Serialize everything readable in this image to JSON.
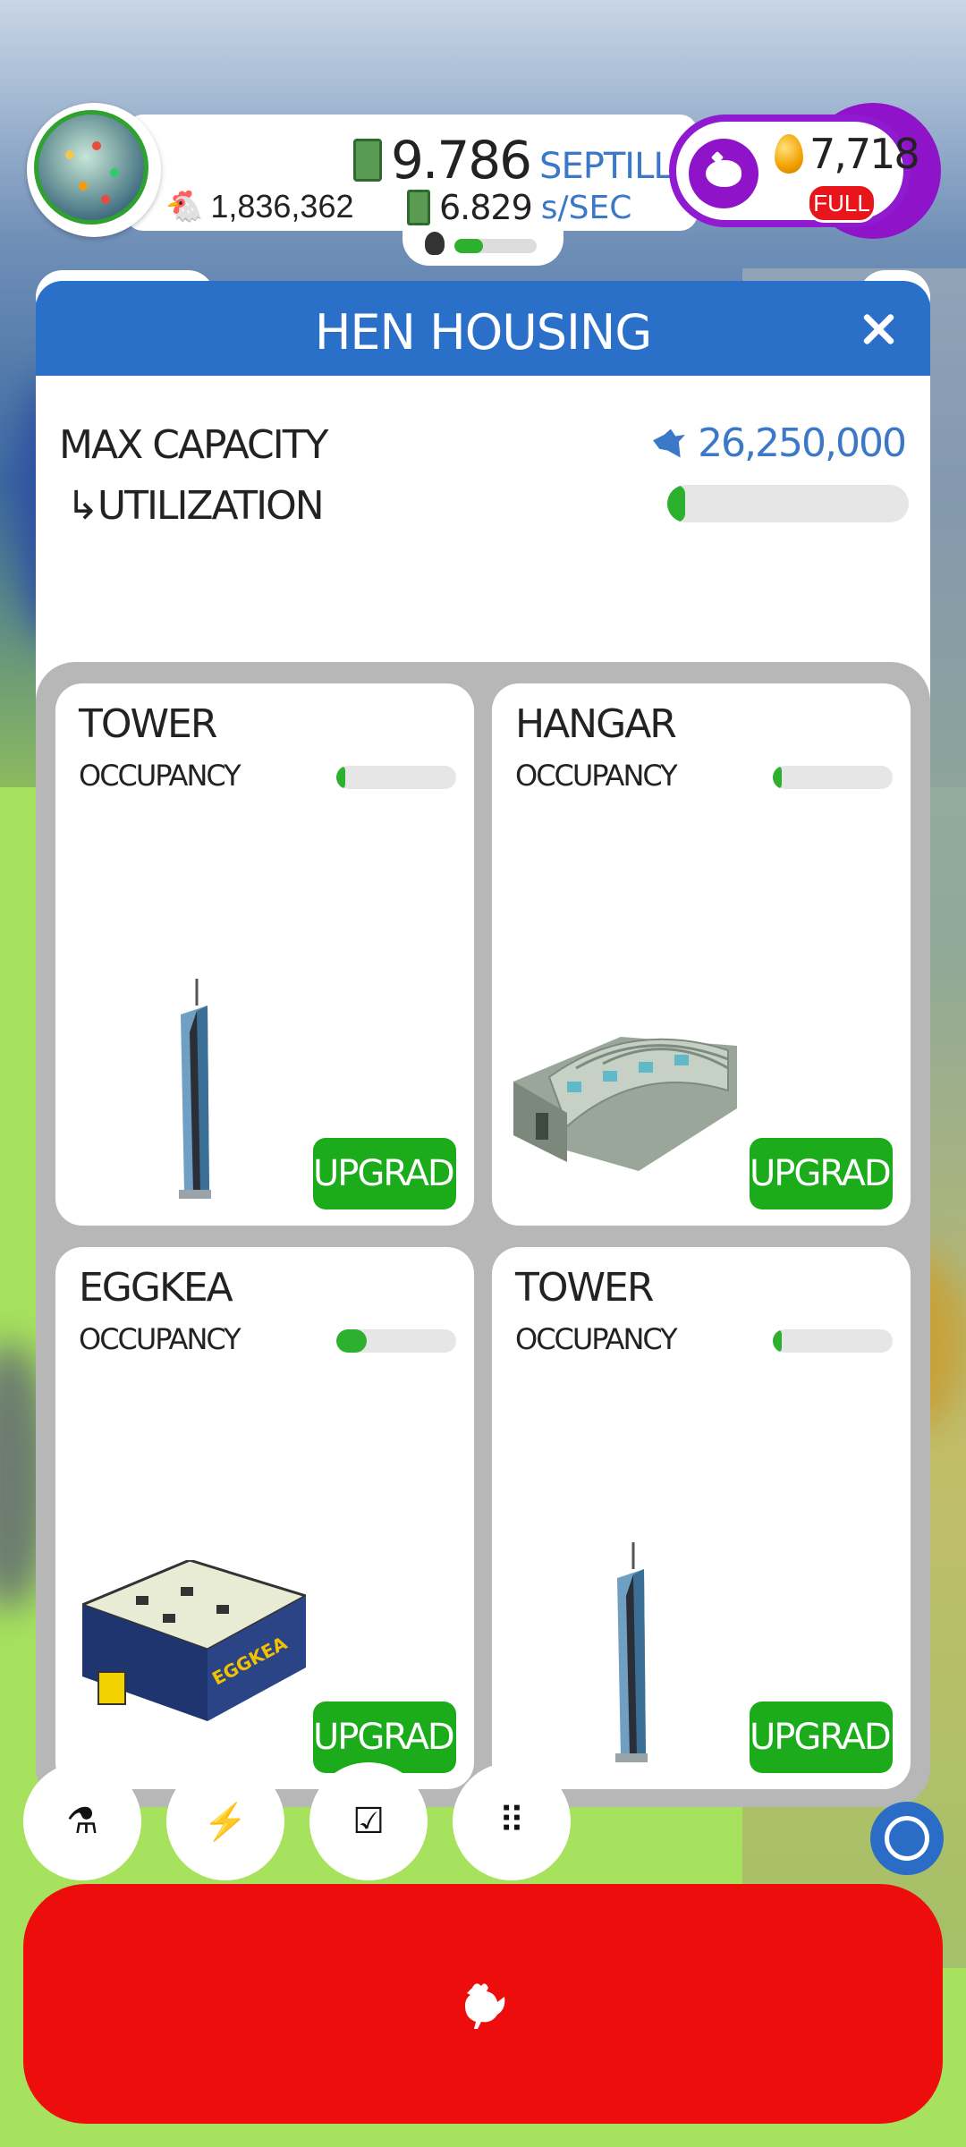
{
  "hud": {
    "hens_count": "1,836,362",
    "money_value": "9.786",
    "money_unit": "SEPTILLION",
    "rate_value": "6.829",
    "rate_unit": "s/SEC",
    "mini_progress": 0.35,
    "golden_eggs": "7,718",
    "piggy_status": "FULL"
  },
  "dialog": {
    "title": "HEN HOUSING",
    "max_capacity_label": "MAX CAPACITY",
    "max_capacity_value": "26,250,000",
    "utilization_label": "↳UTILIZATION",
    "utilization": 0.07
  },
  "houses": [
    {
      "name": "TOWER",
      "occupancy_label": "OCCUPANCY",
      "occupancy": 0.02,
      "button": "UPGRADE",
      "art": "tower"
    },
    {
      "name": "HANGAR",
      "occupancy_label": "OCCUPANCY",
      "occupancy": 0.07,
      "button": "UPGRADE",
      "art": "hangar"
    },
    {
      "name": "EGGKEA",
      "occupancy_label": "OCCUPANCY",
      "occupancy": 0.25,
      "button": "UPGRADE",
      "art": "eggkea",
      "sign": "EGGKEA"
    },
    {
      "name": "TOWER",
      "occupancy_label": "OCCUPANCY",
      "occupancy": 0.02,
      "button": "UPGRADE",
      "art": "tower"
    }
  ],
  "toolbar": {
    "icons": [
      "flask-icon",
      "lightning-icon",
      "checklist-icon",
      "grid-icon"
    ],
    "glyphs": [
      "⚗",
      "⚡",
      "☑",
      "⠿"
    ]
  },
  "colors": {
    "dialog_header": "#2a6fc8",
    "progress_green": "#2db02d",
    "upgrade_green": "#1bab1b",
    "hatch_red": "#ee0d0d",
    "piggy_purple": "#8f14c9",
    "accent_blue": "#3b78c8"
  }
}
